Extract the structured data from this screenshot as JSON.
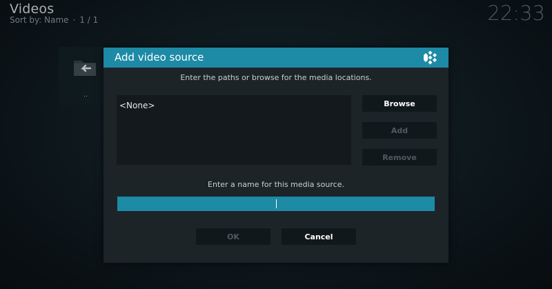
{
  "header": {
    "title": "Videos",
    "sort_label": "Sort by: Name",
    "separator": "·",
    "page_info": "1 / 1",
    "clock": "22:33"
  },
  "background_tile": {
    "label": "..",
    "icon": "folder-back-icon"
  },
  "dialog": {
    "title": "Add video source",
    "logo_icon": "kodi-logo-icon",
    "instruction": "Enter the paths or browse for the media locations.",
    "paths": [
      "<None>"
    ],
    "browse_label": "Browse",
    "add_label": "Add",
    "remove_label": "Remove",
    "name_label": "Enter a name for this media source.",
    "name_value": "",
    "ok_label": "OK",
    "cancel_label": "Cancel"
  },
  "colors": {
    "accent": "#1d8aa6",
    "dialog_bg": "#1c2428",
    "disabled_text": "#4e5a5f"
  }
}
